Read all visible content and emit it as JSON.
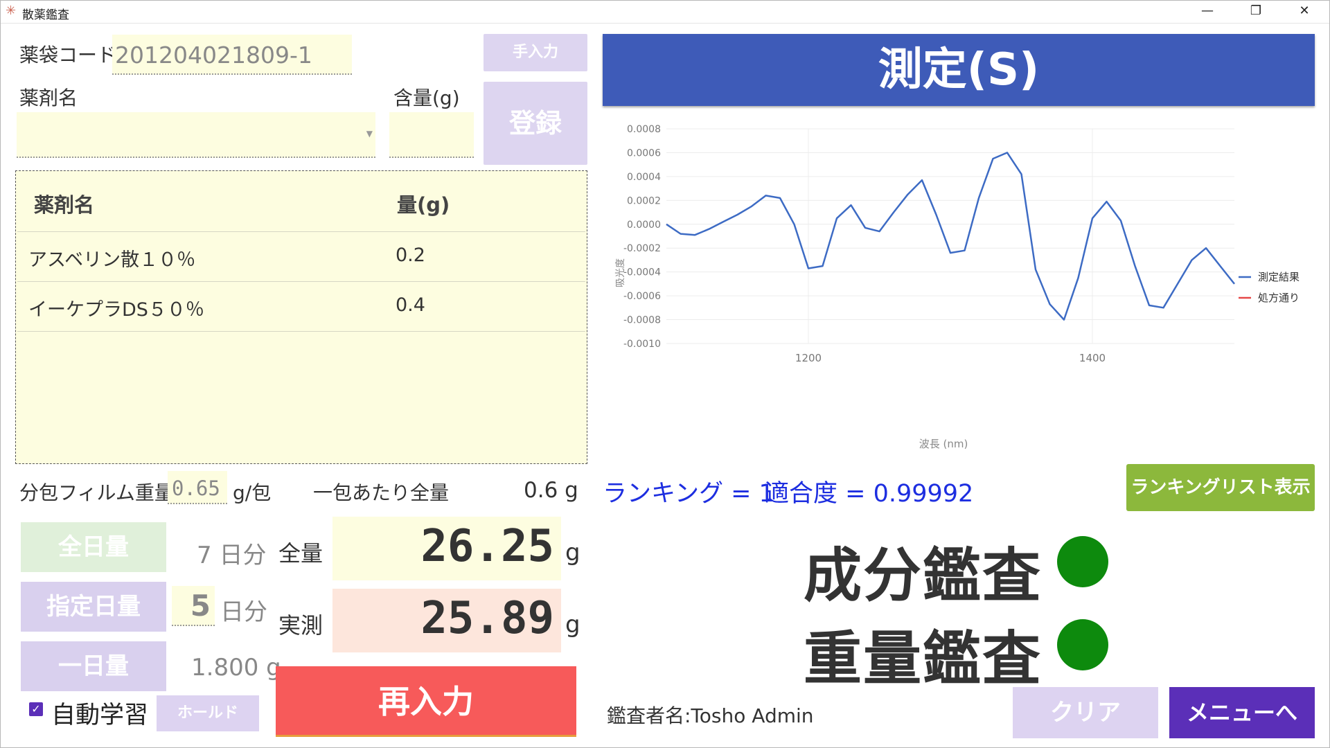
{
  "window": {
    "title": "散薬鑑査",
    "icon": "app-star-icon",
    "minimize_glyph": "—",
    "maximize_glyph": "❐",
    "close_glyph": "✕"
  },
  "form": {
    "bag_code_label": "薬袋コード",
    "bag_code_value": "201204021809-1",
    "manual_input_label": "手入力",
    "drug_name_label": "薬剤名",
    "amount_label": "含量(g)",
    "amount_value": "",
    "register_label": "登録"
  },
  "table": {
    "headers": [
      "薬剤名",
      "量(g)"
    ],
    "rows": [
      {
        "name": "アスベリン散１０％",
        "amount": "0.2"
      },
      {
        "name": "イーケプラDS５０％",
        "amount": "0.4"
      }
    ]
  },
  "film": {
    "label": "分包フィルム重量",
    "value": "0.65",
    "unit": "g/包",
    "per_pack_label": "一包あたり全量",
    "per_pack_value": "0.6 g"
  },
  "dose": {
    "all_day_label": "全日量",
    "all_day_days": "7 日分",
    "spec_day_label": "指定日量",
    "spec_day_value": "5",
    "spec_day_unit": "日分",
    "one_day_label": "一日量",
    "one_day_value": "1.800 g",
    "total_label": "全量",
    "total_value": "26.25",
    "actual_label": "実測",
    "actual_value": "25.89",
    "unit_g": "g"
  },
  "controls": {
    "reinput_label": "再入力",
    "auto_learn_label": "自動学習",
    "auto_learn_checked": "✓",
    "hold_label": "ホールド"
  },
  "measure": {
    "button_label": "測定(S)"
  },
  "chart_data": {
    "type": "line",
    "xlabel": "波長 (nm)",
    "ylabel": "吸光度",
    "xlim": [
      1100,
      1500
    ],
    "ylim": [
      -0.001,
      0.0008
    ],
    "x_ticks": [
      "1200",
      "1400"
    ],
    "x_tick_values": [
      1200,
      1400
    ],
    "y_ticks": [
      "0.0008",
      "0.0006",
      "0.0004",
      "0.0002",
      "0.0000",
      "-0.0002",
      "-0.0004",
      "-0.0006",
      "-0.0008",
      "-0.0010"
    ],
    "y_tick_values": [
      0.0008,
      0.0006,
      0.0004,
      0.0002,
      0.0,
      -0.0002,
      -0.0004,
      -0.0006,
      -0.0008,
      -0.001
    ],
    "grid": true,
    "legend_position": "right",
    "series": [
      {
        "name": "測定結果",
        "color": "#3d6bc4",
        "x": [
          1100,
          1110,
          1120,
          1130,
          1140,
          1150,
          1160,
          1170,
          1180,
          1190,
          1200,
          1210,
          1220,
          1230,
          1240,
          1250,
          1260,
          1270,
          1280,
          1290,
          1300,
          1310,
          1320,
          1330,
          1340,
          1350,
          1360,
          1370,
          1380,
          1390,
          1400,
          1410,
          1420,
          1430,
          1440,
          1450,
          1460,
          1470,
          1480,
          1490,
          1500
        ],
        "y": [
          0.0,
          -8e-05,
          -9e-05,
          -4e-05,
          2e-05,
          8e-05,
          0.00015,
          0.00024,
          0.00022,
          0.0,
          -0.00037,
          -0.00035,
          5e-05,
          0.00016,
          -3e-05,
          -6e-05,
          0.0001,
          0.00025,
          0.00037,
          8e-05,
          -0.00024,
          -0.00022,
          0.00022,
          0.00055,
          0.0006,
          0.00042,
          -0.00038,
          -0.00067,
          -0.0008,
          -0.00045,
          5e-05,
          0.00019,
          3e-05,
          -0.00035,
          -0.00068,
          -0.0007,
          -0.0005,
          -0.0003,
          -0.0002,
          -0.00035,
          -0.0005
        ]
      },
      {
        "name": "処方通り",
        "color": "#e64848",
        "x": [
          1100,
          1110,
          1120,
          1130,
          1140,
          1150,
          1160,
          1170,
          1180,
          1190,
          1200,
          1210,
          1220,
          1230,
          1240,
          1250,
          1260,
          1270,
          1280,
          1290,
          1300,
          1310,
          1320,
          1330,
          1340,
          1350,
          1360,
          1370,
          1380,
          1390,
          1400,
          1410,
          1420,
          1430,
          1440,
          1450,
          1460,
          1470,
          1480,
          1490,
          1500
        ],
        "y": [
          0.0,
          -8e-05,
          -9e-05,
          -4e-05,
          2e-05,
          8e-05,
          0.00015,
          0.00024,
          0.00022,
          0.0,
          -0.00037,
          -0.00035,
          5e-05,
          0.00016,
          -3e-05,
          -6e-05,
          0.0001,
          0.00025,
          0.00037,
          8e-05,
          -0.00024,
          -0.00022,
          0.00022,
          0.00055,
          0.0006,
          0.00042,
          -0.00038,
          -0.00067,
          -0.0008,
          -0.00045,
          5e-05,
          0.00019,
          3e-05,
          -0.00035,
          -0.00068,
          -0.0007,
          -0.0005,
          -0.0003,
          -0.0002,
          -0.00035,
          -0.0005
        ]
      }
    ]
  },
  "result": {
    "ranking_text": "ランキング = 1",
    "fitness_text": "適合度 = 0.99992",
    "ranking_list_label": "ランキングリスト表示",
    "component_check_label": "成分鑑査",
    "weight_check_label": "重量鑑査",
    "status_color": "#0d8a0d"
  },
  "footer": {
    "inspector_text": "鑑査者名:Tosho Admin",
    "clear_label": "クリア",
    "menu_label": "メニューへ"
  }
}
